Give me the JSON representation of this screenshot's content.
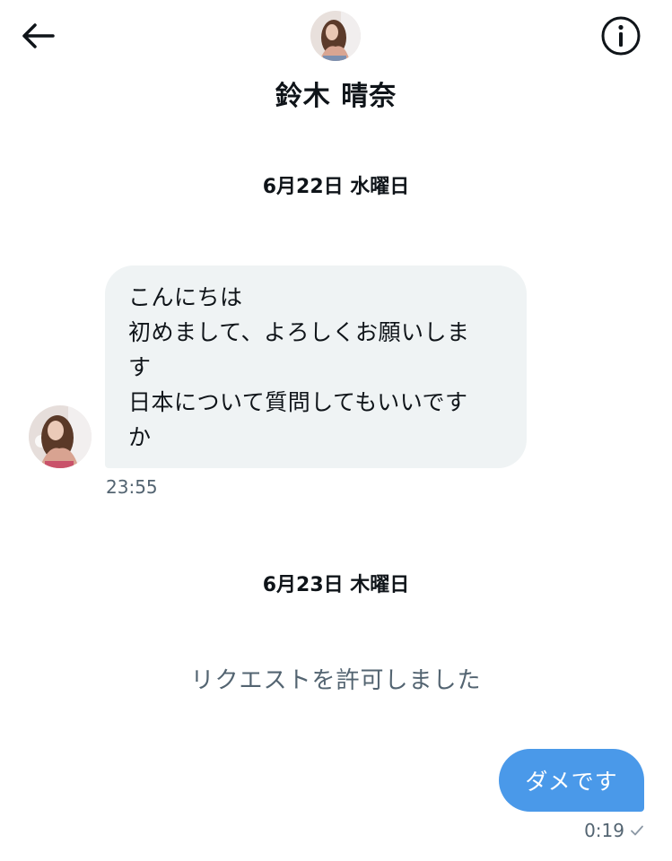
{
  "header": {
    "contact_name": "鈴木 晴奈",
    "back_icon": "arrow-left-icon",
    "info_icon": "info-circle-icon"
  },
  "conversation": {
    "dates": [
      "6月22日 水曜日",
      "6月23日 木曜日"
    ],
    "received_message": {
      "text": "こんにちは\n初めまして、よろしくお願いしま\nす\n日本について質問してもいいです\nか",
      "time": "23:55"
    },
    "system_notice": "リクエストを許可しました",
    "sent_message": {
      "text": "ダメです",
      "time": "0:19",
      "status_icon": "check-icon"
    }
  },
  "colors": {
    "sent_bubble": "#4a99e9",
    "received_bubble": "#eff3f4",
    "muted_text": "#536471"
  }
}
